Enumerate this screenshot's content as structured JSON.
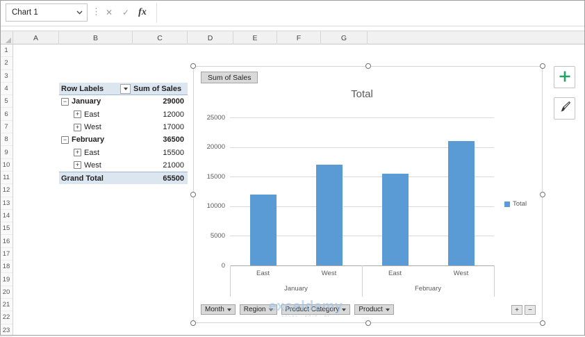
{
  "formula_bar": {
    "name_box": "Chart 1",
    "splitter_glyph": "⋮",
    "cancel_glyph": "✕",
    "confirm_glyph": "✓",
    "fx_label": "fx",
    "formula_value": ""
  },
  "sheet": {
    "columns": [
      "A",
      "B",
      "C",
      "D",
      "E",
      "F",
      "G"
    ],
    "rows": [
      "1",
      "2",
      "3",
      "4",
      "5",
      "6",
      "7",
      "8",
      "9",
      "10",
      "11",
      "12",
      "13",
      "14",
      "15",
      "16",
      "17",
      "18",
      "19",
      "20",
      "21",
      "22",
      "23"
    ]
  },
  "pivot": {
    "header_row_labels": "Row Labels",
    "header_values": "Sum of Sales",
    "rows": [
      {
        "label": "January",
        "value": "29000",
        "indent": 0,
        "expand": "expanded",
        "bold": true,
        "total": false
      },
      {
        "label": "East",
        "value": "12000",
        "indent": 1,
        "expand": "collapsed",
        "bold": false,
        "total": false
      },
      {
        "label": "West",
        "value": "17000",
        "indent": 1,
        "expand": "collapsed",
        "bold": false,
        "total": false
      },
      {
        "label": "February",
        "value": "36500",
        "indent": 0,
        "expand": "expanded",
        "bold": true,
        "total": false
      },
      {
        "label": "East",
        "value": "15500",
        "indent": 1,
        "expand": "collapsed",
        "bold": false,
        "total": false
      },
      {
        "label": "West",
        "value": "21000",
        "indent": 1,
        "expand": "collapsed",
        "bold": false,
        "total": false
      },
      {
        "label": "Grand Total",
        "value": "65500",
        "indent": 0,
        "expand": null,
        "bold": true,
        "total": true
      }
    ]
  },
  "chart": {
    "field_button": "Sum of Sales",
    "title": "Total",
    "field_buttons": [
      "Month",
      "Region",
      "Product Category",
      "Product"
    ],
    "expand_collapse_buttons": [
      "+",
      "−"
    ],
    "watermark": {
      "line1": "exceldemy",
      "line2": "EXCEL · DATA · BI"
    }
  },
  "chart_data": {
    "type": "bar",
    "title": "Total",
    "categories": [
      "East",
      "West",
      "East",
      "West"
    ],
    "groups": [
      {
        "label": "January",
        "span": 2
      },
      {
        "label": "February",
        "span": 2
      }
    ],
    "values": [
      12000,
      17000,
      15500,
      21000
    ],
    "series": [
      {
        "name": "Total",
        "values": [
          12000,
          17000,
          15500,
          21000
        ]
      }
    ],
    "ylim": [
      0,
      25000
    ],
    "ytick_step": 5000,
    "legend": [
      "Total"
    ],
    "legend_position": "right",
    "bar_color": "#5B9BD5",
    "grid": true
  }
}
